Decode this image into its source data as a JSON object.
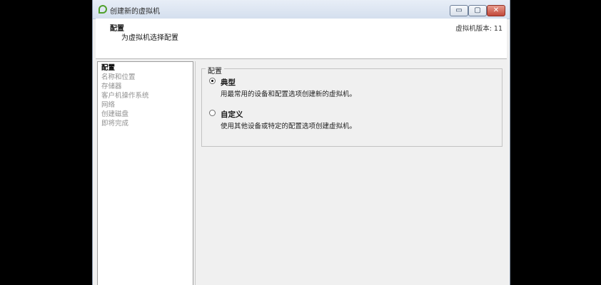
{
  "window": {
    "title": "创建新的虚拟机",
    "controls": {
      "minimize": "▭",
      "maximize": "▢",
      "close": "✕"
    }
  },
  "header": {
    "title": "配置",
    "subtitle": "为虚拟机选择配置",
    "version": "虚拟机版本: 11"
  },
  "nav": {
    "items": [
      {
        "label": "配置",
        "active": true
      },
      {
        "label": "名称和位置",
        "active": false
      },
      {
        "label": "存储器",
        "active": false
      },
      {
        "label": "客户机操作系统",
        "active": false
      },
      {
        "label": "网络",
        "active": false
      },
      {
        "label": "创建磁盘",
        "active": false
      },
      {
        "label": "即将完成",
        "active": false
      }
    ]
  },
  "config": {
    "group_title": "配置",
    "options": [
      {
        "label": "典型",
        "description": "用最常用的设备和配置选项创建新的虚拟机。",
        "checked": true
      },
      {
        "label": "自定义",
        "description": "使用其他设备或特定的配置选项创建虚拟机。",
        "checked": false
      }
    ]
  },
  "colors": {
    "accent_icon": "#4fa02b",
    "close_button": "#c1483a"
  }
}
